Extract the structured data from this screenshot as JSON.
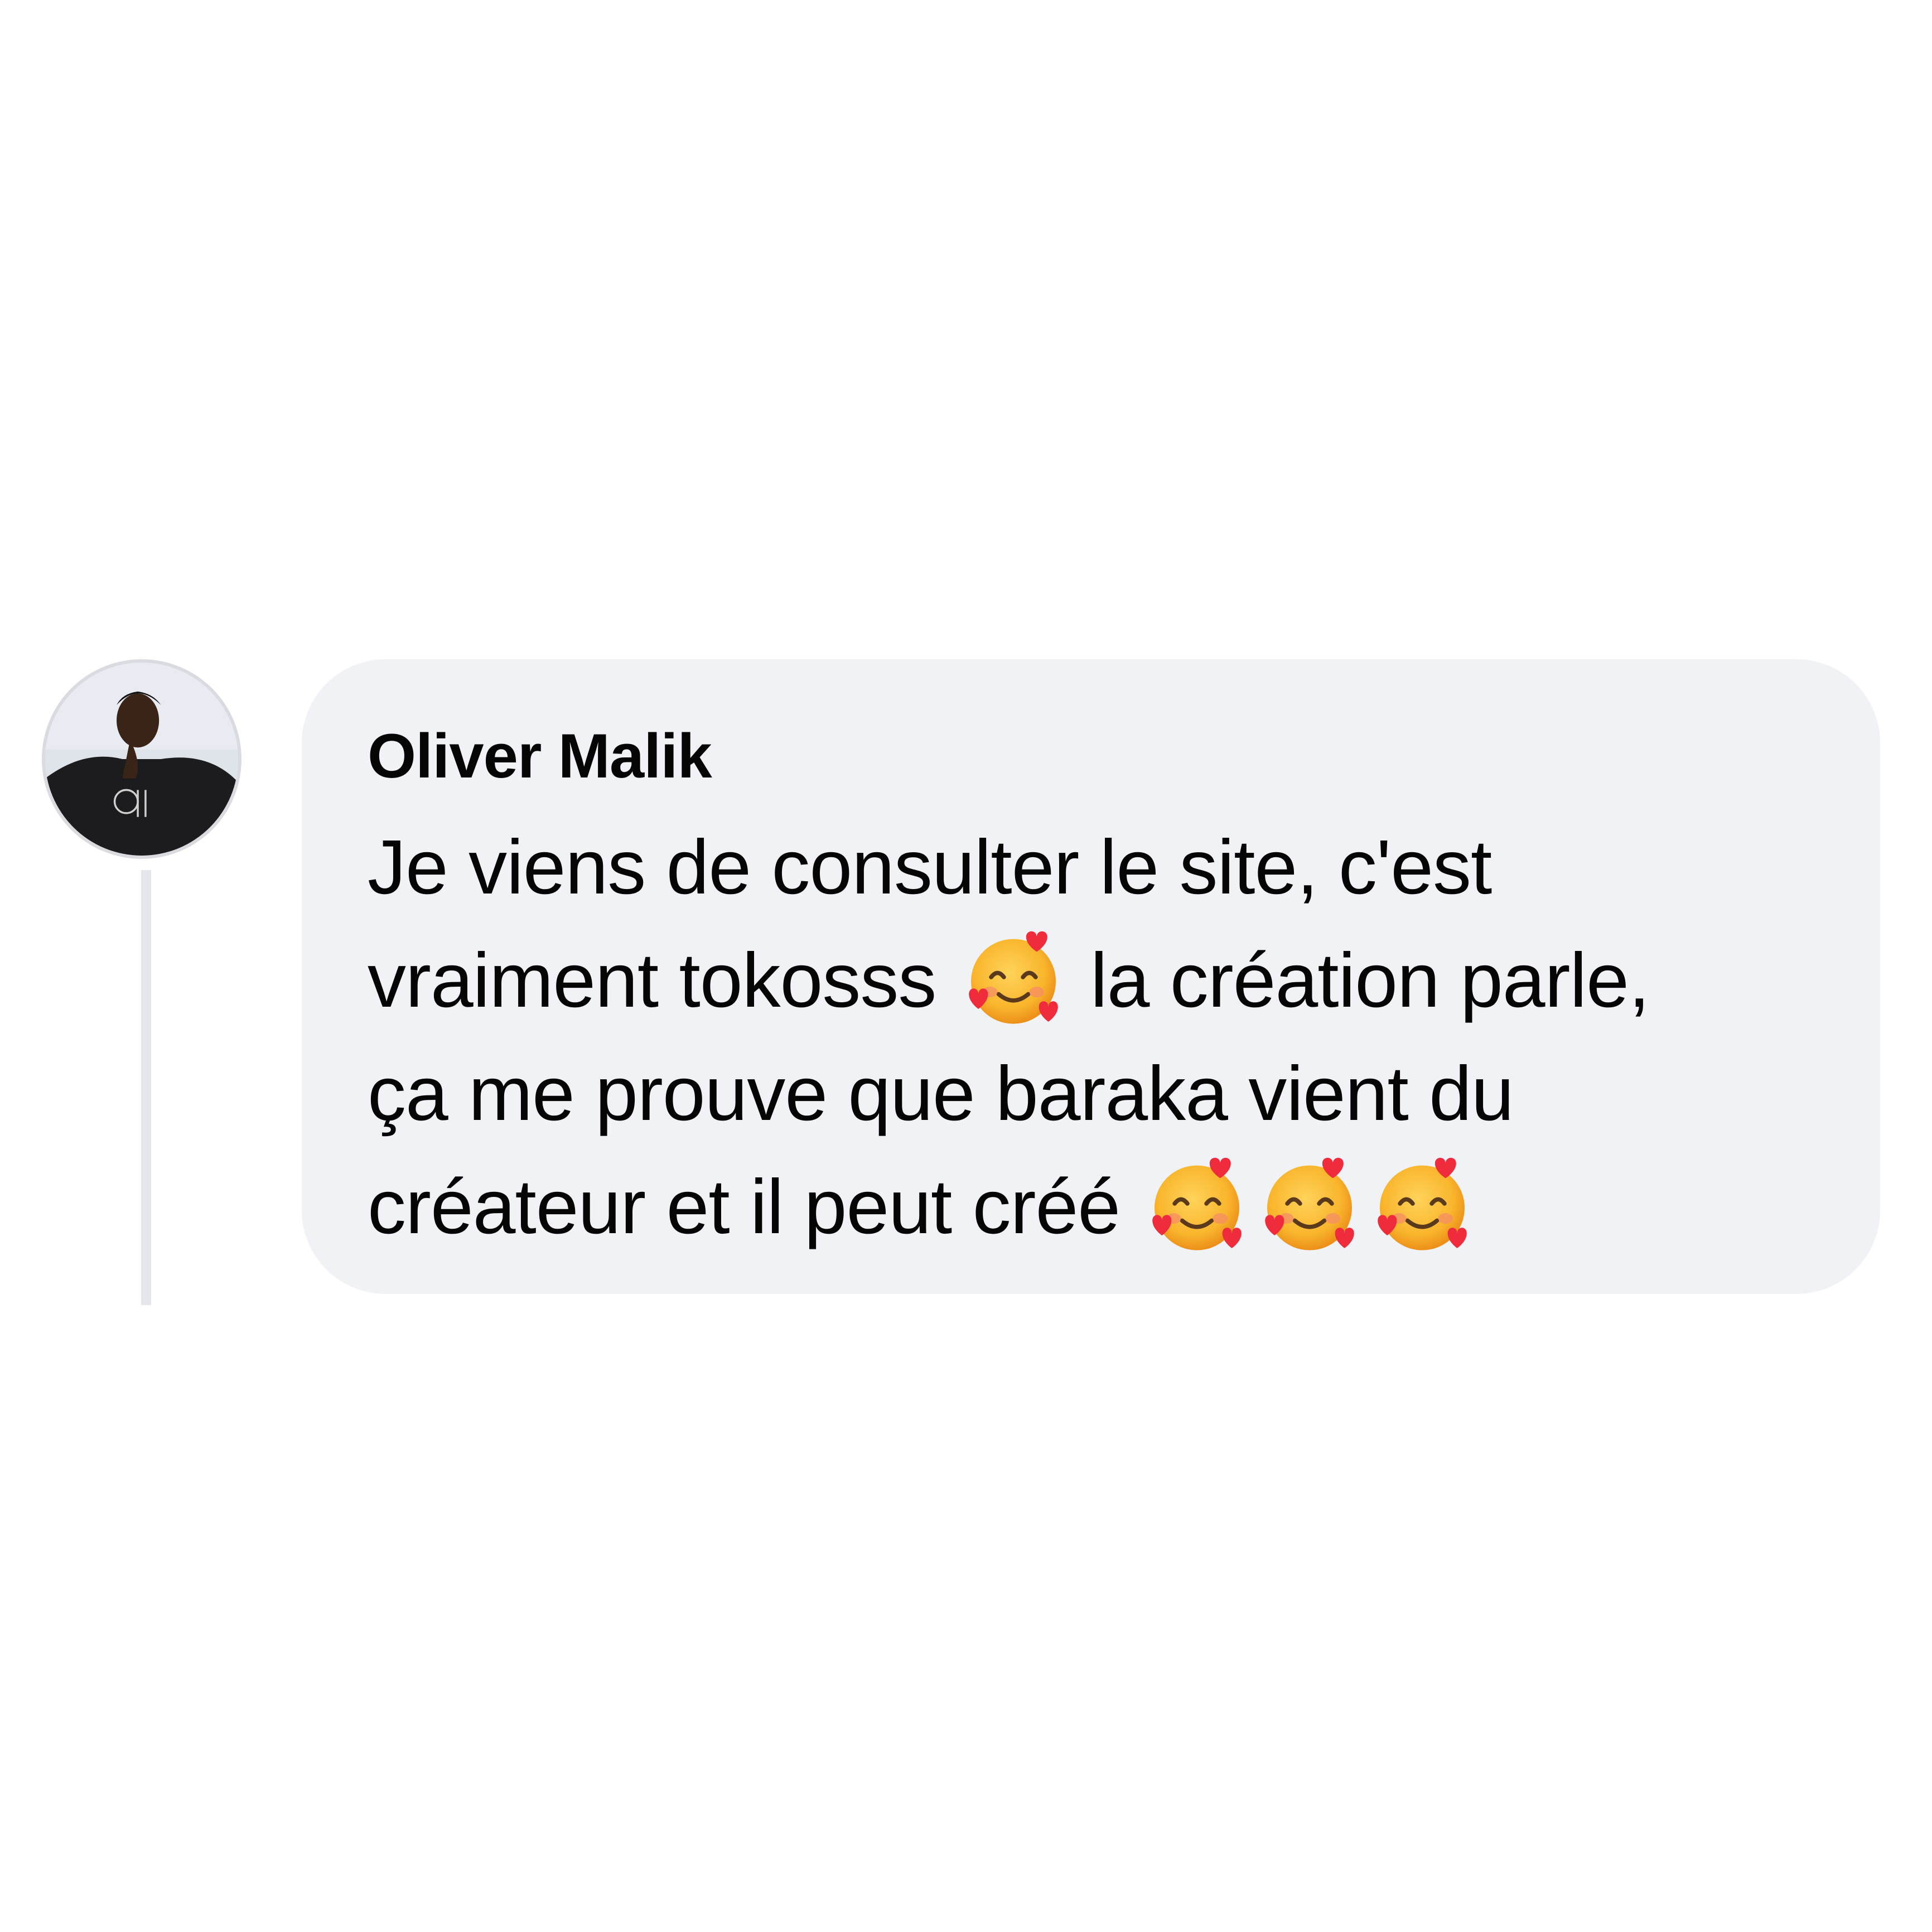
{
  "comment": {
    "author": "Oliver Malik",
    "message_lines": [
      {
        "text": "Je viens de consulter le site, c'est",
        "emoji_after": 0
      },
      {
        "text_before": "vraiment tokosss",
        "emoji_count": 1,
        "text_after": "la création parle,"
      },
      {
        "text": "ça me prouve que baraka vient du",
        "emoji_after": 0
      },
      {
        "text_before": "créateur et il peut créé",
        "emoji_count": 3,
        "text_after": ""
      }
    ],
    "emoji_name": "smiling-face-with-hearts-icon"
  },
  "colors": {
    "bubble_background": "#f0f2f5",
    "text": "#050505",
    "thread_line": "#e4e6eb"
  }
}
